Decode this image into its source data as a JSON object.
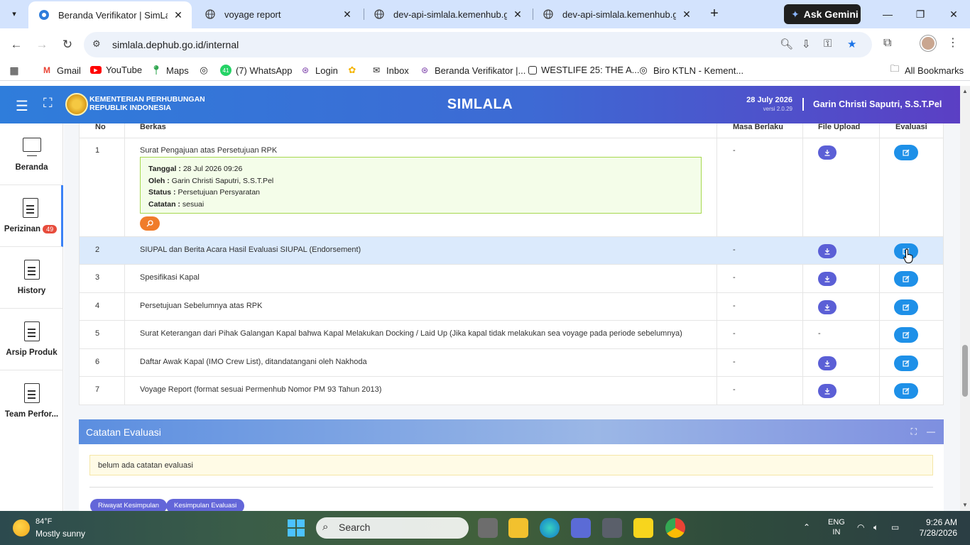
{
  "browser": {
    "tabs": [
      {
        "title": "Beranda Verifikator | SimLala",
        "active": true
      },
      {
        "title": "voyage report",
        "active": false
      },
      {
        "title": "dev-api-simlala.kemenhub.go.id",
        "active": false
      },
      {
        "title": "dev-api-simlala.kemenhub.go.id",
        "active": false
      }
    ],
    "gemini_label": "Ask Gemini",
    "url": "simlala.dephub.go.id/internal",
    "bookmarks": [
      "Gmail",
      "YouTube",
      "Maps",
      "",
      "(7) WhatsApp",
      "Login",
      "",
      "Inbox",
      "Beranda Verifikator |...",
      "WESTLIFE 25: THE A...",
      "Biro KTLN - Kement..."
    ],
    "whatsapp_count": "41",
    "all_bookmarks": "All Bookmarks"
  },
  "header": {
    "ministry_line1": "KEMENTERIAN PERHUBUNGAN",
    "ministry_line2": "REPUBLIK INDONESIA",
    "app_title": "SIMLALA",
    "date": "28 July 2026",
    "version": "versi 2.0.29",
    "user": "Garin Christi Saputri, S.S.T.Pel"
  },
  "sidebar": {
    "items": [
      {
        "label": "Beranda",
        "icon": "monitor-icon"
      },
      {
        "label": "Perizinan",
        "icon": "document-icon",
        "badge": "49"
      },
      {
        "label": "History",
        "icon": "document-icon"
      },
      {
        "label": "Arsip Produk",
        "icon": "document-icon"
      },
      {
        "label": "Team Perfor...",
        "icon": "document-icon"
      }
    ]
  },
  "table": {
    "headers": {
      "no": "No",
      "berkas": "Berkas",
      "masa": "Masa Berlaku",
      "upload": "File Upload",
      "evaluasi": "Evaluasi"
    },
    "rows": [
      {
        "no": "1",
        "name": "Surat Pengajuan atas Persetujuan RPK",
        "masa": "-",
        "upload": "download",
        "evaluasi": "edit"
      },
      {
        "no": "2",
        "name": "SIUPAL dan Berita Acara Hasil Evaluasi SIUPAL (Endorsement)",
        "masa": "-",
        "upload": "download",
        "evaluasi": "edit"
      },
      {
        "no": "3",
        "name": "Spesifikasi Kapal",
        "masa": "-",
        "upload": "download",
        "evaluasi": "edit"
      },
      {
        "no": "4",
        "name": "Persetujuan Sebelumnya atas RPK",
        "masa": "-",
        "upload": "download",
        "evaluasi": "edit"
      },
      {
        "no": "5",
        "name": "Surat Keterangan dari Pihak Galangan Kapal bahwa Kapal Melakukan Docking / Laid Up (Jika kapal tidak melakukan sea voyage pada periode sebelumnya)",
        "masa": "-",
        "upload": "-",
        "evaluasi": "edit"
      },
      {
        "no": "6",
        "name": "Daftar Awak Kapal (IMO Crew List), ditandatangani oleh Nakhoda",
        "masa": "-",
        "upload": "download",
        "evaluasi": "edit"
      },
      {
        "no": "7",
        "name": "Voyage Report (format sesuai Permenhub Nomor PM 93 Tahun 2013)",
        "masa": "-",
        "upload": "download",
        "evaluasi": "edit"
      }
    ],
    "row1_info": {
      "tanggal_label": "Tanggal :",
      "tanggal": "28 Jul 2026 09:26",
      "oleh_label": "Oleh :",
      "oleh": "Garin Christi Saputri, S.S.T.Pel",
      "status_label": "Status :",
      "status": "Persetujuan Persyaratan",
      "catatan_label": "Catatan :",
      "catatan": "sesuai"
    }
  },
  "evaluasi_card": {
    "title": "Catatan Evaluasi",
    "note": "belum ada catatan evaluasi",
    "btn_riwayat": "Riwayat Kesimpulan",
    "btn_kesimpulan": "Kesimpulan Evaluasi"
  },
  "taskbar": {
    "temp": "84°F",
    "weather": "Mostly sunny",
    "search": "Search",
    "lang1": "ENG",
    "lang2": "IN",
    "time": "9:26 AM",
    "date": "7/28/2026"
  }
}
